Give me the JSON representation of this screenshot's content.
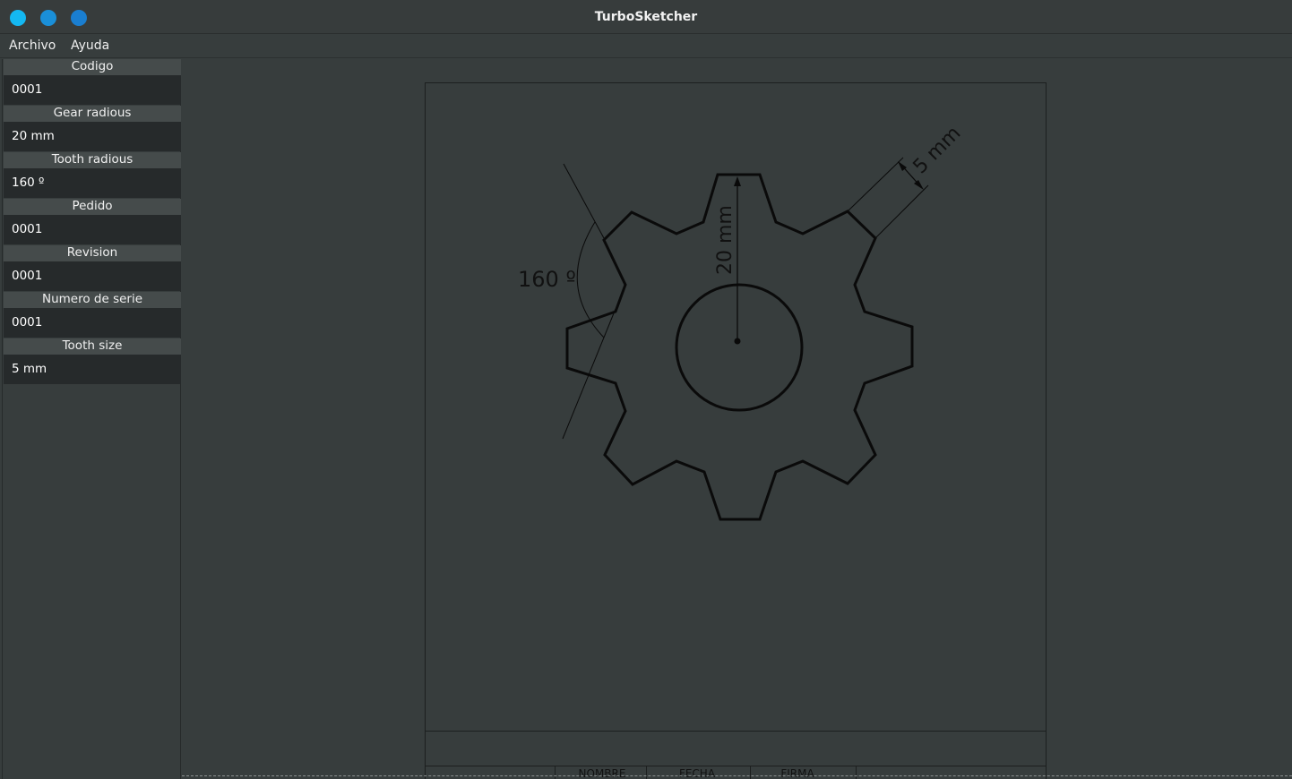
{
  "window": {
    "title": "TurboSketcher",
    "buttons": [
      "close",
      "minimize",
      "maximize"
    ],
    "button_colors": [
      "#14b8f2",
      "#1a8fd8",
      "#1a7ed0"
    ]
  },
  "menu": {
    "items": [
      "Archivo",
      "Ayuda"
    ]
  },
  "sidebar": {
    "fields": [
      {
        "label": "Codigo",
        "value": "0001"
      },
      {
        "label": "Gear radious",
        "value": "20 mm"
      },
      {
        "label": "Tooth radious",
        "value": "160 º"
      },
      {
        "label": "Pedido",
        "value": "0001"
      },
      {
        "label": "Revision",
        "value": "0001"
      },
      {
        "label": "Numero de serie",
        "value": "0001"
      },
      {
        "label": "Tooth size",
        "value": "5 mm"
      }
    ]
  },
  "drawing": {
    "gear_radius_label": "20 mm",
    "tooth_angle_label": "160 º",
    "tooth_size_label": "5 mm",
    "title_block": {
      "columns": [
        "NOMBRE",
        "FECHA",
        "FIRMA"
      ]
    }
  }
}
